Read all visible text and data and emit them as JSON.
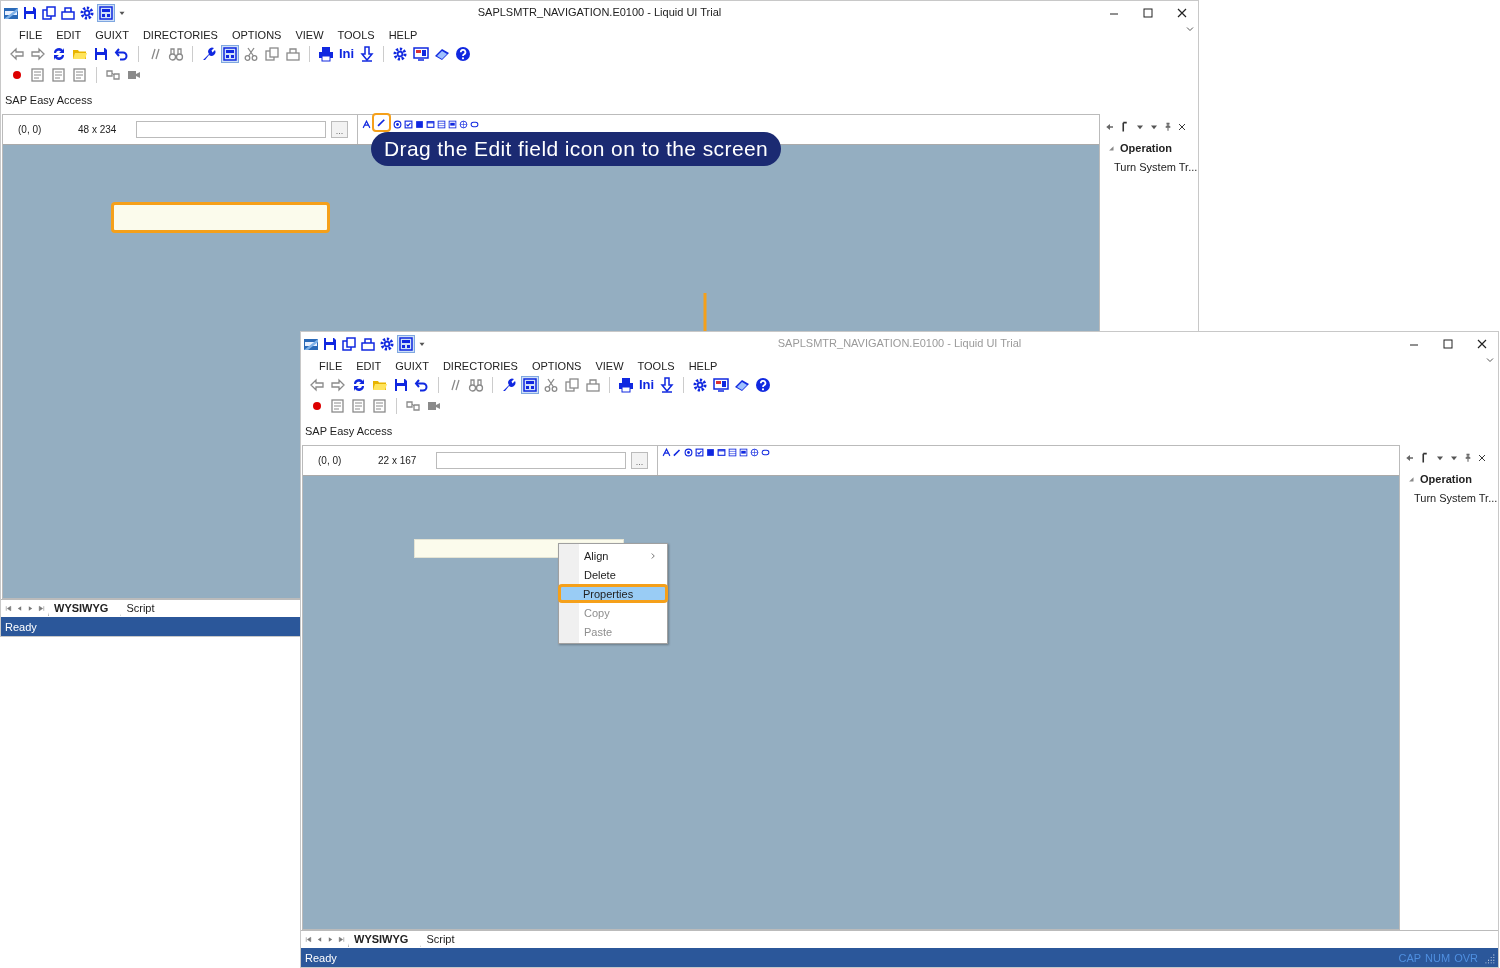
{
  "windows": [
    {
      "title": "SAPLSMTR_NAVIGATION.E0100 - Liquid UI Trial",
      "active": true,
      "design_mode": true,
      "menu": [
        "FILE",
        "EDIT",
        "GUIXT",
        "DIRECTORIES",
        "OPTIONS",
        "VIEW",
        "TOOLS",
        "HELP"
      ],
      "ini_label": "Ini",
      "screen_label": "SAP Easy Access",
      "coordinates": "(0, 0)",
      "size": "48 x 234",
      "browse_button": "...",
      "edit_tool_highlighted": true,
      "panel": {
        "heading": "Operation",
        "items": [
          "Turn System Tr..."
        ]
      },
      "canvas": {
        "field": {
          "highlighted": true
        }
      },
      "tabs": [
        {
          "label": "WYSIWYG",
          "selected": true
        },
        {
          "label": "Script",
          "selected": false
        }
      ],
      "status": "Ready"
    },
    {
      "title": "SAPLSMTR_NAVIGATION.E0100 - Liquid UI Trial",
      "active": false,
      "design_mode": true,
      "menu": [
        "FILE",
        "EDIT",
        "GUIXT",
        "DIRECTORIES",
        "OPTIONS",
        "VIEW",
        "TOOLS",
        "HELP"
      ],
      "ini_label": "Ini",
      "screen_label": "SAP Easy Access",
      "coordinates": "(0, 0)",
      "size": "22 x 167",
      "browse_button": "...",
      "edit_tool_highlighted": false,
      "panel": {
        "heading": "Operation",
        "items": [
          "Turn System Tr..."
        ]
      },
      "canvas": {
        "field": {
          "highlighted": false
        },
        "context_menu": [
          {
            "label": "Align",
            "submenu": true,
            "selected": false,
            "disabled": false,
            "highlighted": false
          },
          {
            "label": "Delete",
            "submenu": false,
            "selected": false,
            "disabled": false,
            "highlighted": false
          },
          {
            "label": "Properties",
            "submenu": false,
            "selected": true,
            "disabled": false,
            "highlighted": true
          },
          {
            "label": "Copy",
            "submenu": false,
            "selected": false,
            "disabled": true,
            "highlighted": false
          },
          {
            "label": "Paste",
            "submenu": false,
            "selected": false,
            "disabled": true,
            "highlighted": false
          }
        ]
      },
      "tabs": [
        {
          "label": "WYSIWYG",
          "selected": true
        },
        {
          "label": "Script",
          "selected": false
        }
      ],
      "status": "Ready",
      "indicators": [
        "CAP",
        "NUM",
        "OVR"
      ]
    }
  ],
  "callout": "Drag the Edit field icon on to the screen"
}
